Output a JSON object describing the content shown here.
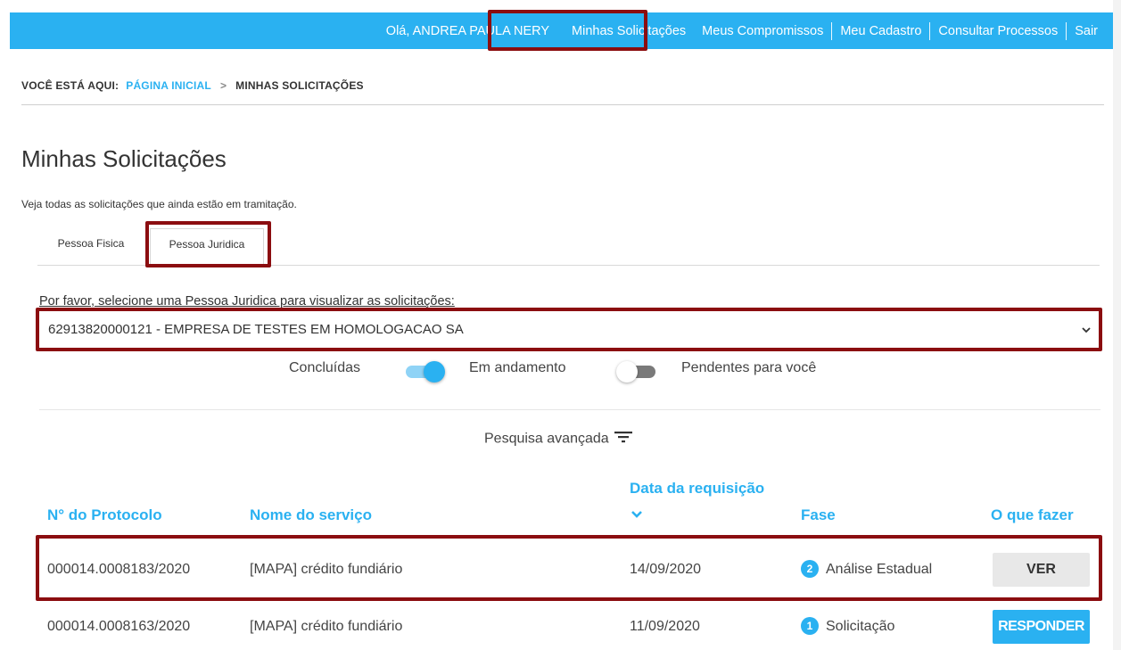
{
  "nav": {
    "greeting": "Olá, ANDREA PAULA NERY",
    "items": [
      "Minhas Solicitações",
      "Meus Compromissos",
      "Meu Cadastro",
      "Consultar Processos",
      "Sair"
    ]
  },
  "breadcrumb": {
    "prefix": "VOCÊ ESTÁ AQUI:",
    "home": "PÁGINA INICIAL",
    "separator": ">",
    "current": "MINHAS SOLICITAÇÕES"
  },
  "page": {
    "title": "Minhas Solicitações",
    "subtitle": "Veja todas as solicitações que ainda estão em tramitação."
  },
  "tabs": [
    "Pessoa Fisica",
    "Pessoa Juridica"
  ],
  "active_tab": "Pessoa Juridica",
  "company_select": {
    "label": "Por favor, selecione uma Pessoa Juridica para visualizar as solicitações:",
    "value": "62913820000121 - EMPRESA DE TESTES EM HOMOLOGACAO SA"
  },
  "filters": {
    "concluidas": "Concluídas",
    "em_andamento": "Em andamento",
    "pendentes": "Pendentes para você",
    "switch_1_on": true,
    "switch_2_on": false
  },
  "advanced_search": "Pesquisa avançada",
  "table": {
    "headers": {
      "protocol": "N° do Protocolo",
      "service": "Nome do serviço",
      "date": "Data da requisição",
      "sort_icon": "chevron-down-icon",
      "phase": "Fase",
      "action": "O que fazer"
    },
    "rows": [
      {
        "protocol": "000014.0008183/2020",
        "service": "[MAPA] crédito fundiário",
        "date": "14/09/2020",
        "phase_num": "2",
        "phase": "Análise Estadual",
        "action": "VER"
      },
      {
        "protocol": "000014.0008163/2020",
        "service": "[MAPA] crédito fundiário",
        "date": "11/09/2020",
        "phase_num": "1",
        "phase": "Solicitação",
        "action": "RESPONDER"
      }
    ]
  },
  "colors": {
    "accent": "#2ab1f1",
    "highlight_border": "#8b0d10",
    "text": "#333333"
  }
}
